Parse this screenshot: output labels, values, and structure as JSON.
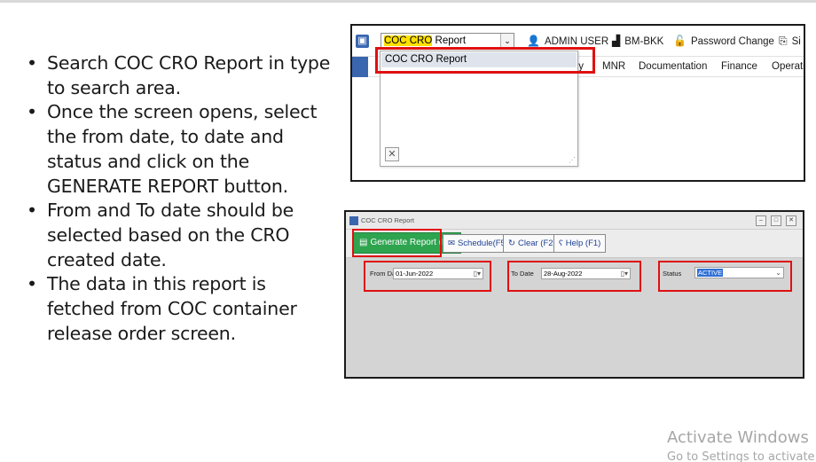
{
  "bullets": [
    "Search COC CRO Report in type to search area.",
    "Once the screen opens, select the from date, to date and status and click on the GENERATE REPORT button.",
    "From and To date should be selected based on the CRO created date.",
    "The data in this report is fetched from COC container release order screen."
  ],
  "bullet_marker": "•",
  "shot1": {
    "search": {
      "highlight": "COC CRO",
      "rest": " Report"
    },
    "dropdown_toggle": "⌄",
    "top_links": {
      "user": "ADMIN USER",
      "branch": "BM-BKK",
      "password": "Password Change",
      "signout": "Si"
    },
    "icons": {
      "user": "person-icon",
      "branch": "building-icon",
      "password": "lock-icon",
      "signout": "signout-icon"
    },
    "menu": [
      "ty",
      "MNR",
      "Documentation",
      "Finance",
      "Operati"
    ],
    "dropdown_item": "COC CRO Report",
    "close_glyph": "✕"
  },
  "shot2": {
    "title": "COC CRO Report",
    "window_buttons": [
      "–",
      "□",
      "✕"
    ],
    "buttons": {
      "generate": "Generate Report (F4)",
      "schedule": "Schedule(F5)",
      "clear": "Clear (F2)",
      "help": "Help (F1)"
    },
    "fields": {
      "from_label": "From Date",
      "from_value": "01-Jun-2022",
      "to_label": "To Date",
      "to_value": "28-Aug-2022",
      "status_label": "Status",
      "status_value": "ACTIVE"
    }
  },
  "watermark": {
    "line1": "Activate Windows",
    "line2": "Go to Settings to activate"
  },
  "colors": {
    "highlight_red": "#e01010",
    "generate_green": "#2ea44f",
    "search_highlight": "#ffe000"
  }
}
